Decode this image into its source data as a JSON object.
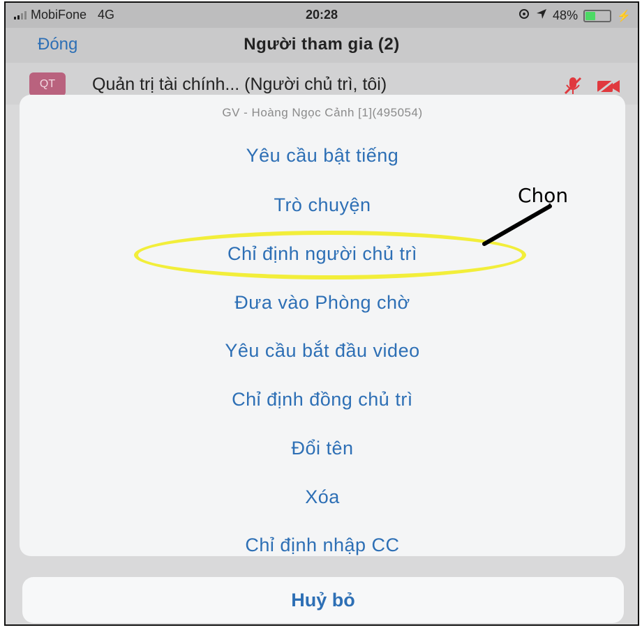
{
  "status_bar": {
    "carrier": "MobiFone",
    "network": "4G",
    "time": "20:28",
    "battery": "48%",
    "battery_level": 0.48
  },
  "nav": {
    "close_label": "Đóng",
    "title": "Người tham gia (2)"
  },
  "participant": {
    "initials": "QT",
    "name": "Quản trị tài chính...  (Người chủ trì, tôi)"
  },
  "sheet": {
    "title": "GV - Hoàng Ngọc Cảnh [1](495054)",
    "options": [
      "Yêu cầu bật tiếng",
      "Trò chuyện",
      "Chỉ định người chủ trì",
      "Đưa vào Phòng chờ",
      "Yêu cầu bắt đầu video",
      "Chỉ định đồng chủ trì",
      "Đổi tên",
      "Xóa",
      "Chỉ định nhập CC"
    ],
    "cancel_label": "Huỷ bỏ"
  },
  "annotation": {
    "label": "Chọn"
  },
  "colors": {
    "accent": "#2d6fb5",
    "highlight": "#f2ee3a",
    "muted_red": "#e0393e"
  }
}
